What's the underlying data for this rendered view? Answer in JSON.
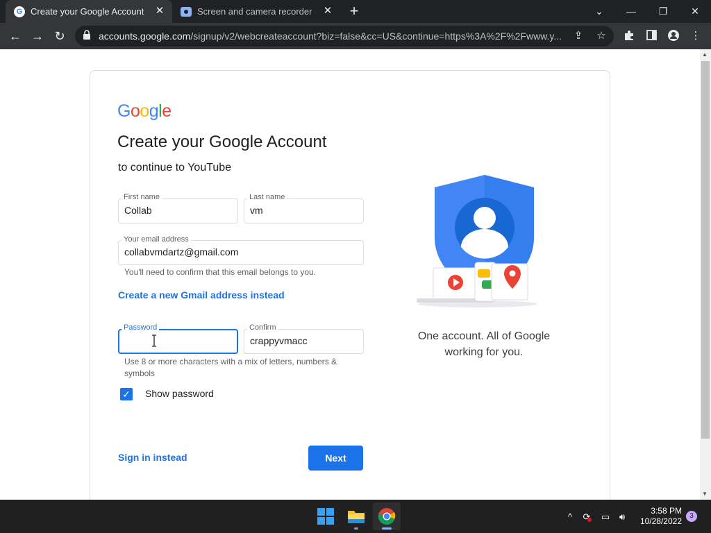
{
  "browser": {
    "tabs": [
      {
        "title": "Create your Google Account",
        "active": true,
        "icon": "google-favicon"
      },
      {
        "title": "Screen and camera recorder - Sc",
        "active": false,
        "icon": "recorder-favicon"
      }
    ],
    "url_host": "accounts.google.com",
    "url_path": "/signup/v2/webcreateaccount?biz=false&cc=US&continue=https%3A%2F%2Fwww.y..."
  },
  "page": {
    "logo_text": "Google",
    "heading": "Create your Google Account",
    "subheading": "to continue to YouTube",
    "first_name": {
      "label": "First name",
      "value": "Collab"
    },
    "last_name": {
      "label": "Last name",
      "value": "vm"
    },
    "email": {
      "label": "Your email address",
      "value": "collabvmdartz@gmail.com",
      "hint": "You'll need to confirm that this email belongs to you."
    },
    "gmail_link": "Create a new Gmail address instead",
    "password": {
      "label": "Password",
      "value": ""
    },
    "confirm": {
      "label": "Confirm",
      "value": "crappyvmacc"
    },
    "password_hint": "Use 8 or more characters with a mix of letters, numbers & symbols",
    "show_password": {
      "label": "Show password",
      "checked": true
    },
    "signin_link": "Sign in instead",
    "next_button": "Next",
    "tagline": "One account. All of Google working for you."
  },
  "taskbar": {
    "time": "3:58 PM",
    "date": "10/28/2022",
    "notification_count": "3"
  },
  "colors": {
    "accent": "#1a73e8",
    "chrome_dark": "#202124",
    "taskbar": "#202020"
  }
}
